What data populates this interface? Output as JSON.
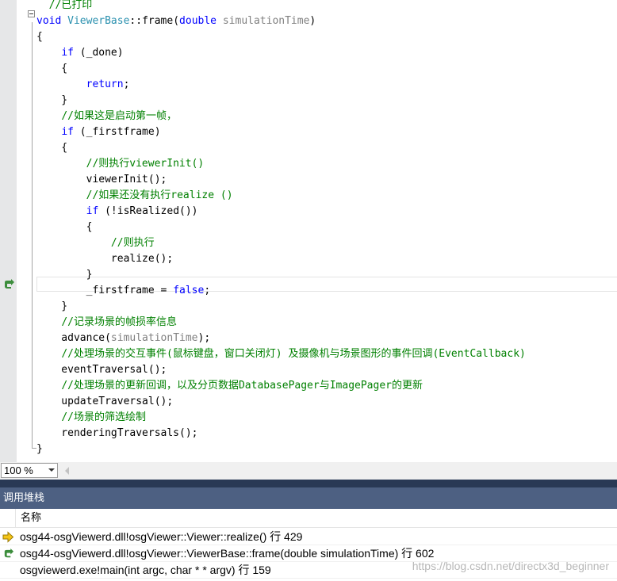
{
  "editor": {
    "lines": [
      {
        "tokens": [
          {
            "t": "  //已打印",
            "c": "cm"
          }
        ]
      },
      {
        "tokens": [
          {
            "t": "void ",
            "c": "kw"
          },
          {
            "t": "ViewerBase",
            "c": "type"
          },
          {
            "t": "::frame(",
            "c": "plain"
          },
          {
            "t": "double ",
            "c": "kw"
          },
          {
            "t": "simulationTime",
            "c": "param"
          },
          {
            "t": ")",
            "c": "plain"
          }
        ]
      },
      {
        "tokens": [
          {
            "t": "{",
            "c": "plain"
          }
        ]
      },
      {
        "tokens": [
          {
            "t": "    ",
            "c": "plain"
          },
          {
            "t": "if",
            "c": "kw"
          },
          {
            "t": " (_done)",
            "c": "plain"
          }
        ]
      },
      {
        "tokens": [
          {
            "t": "    {",
            "c": "plain"
          }
        ]
      },
      {
        "tokens": [
          {
            "t": "        ",
            "c": "plain"
          },
          {
            "t": "return",
            "c": "kw"
          },
          {
            "t": ";",
            "c": "plain"
          }
        ]
      },
      {
        "tokens": [
          {
            "t": "    }",
            "c": "plain"
          }
        ]
      },
      {
        "tokens": [
          {
            "t": "    ",
            "c": "plain"
          },
          {
            "t": "//如果这是启动第一帧，",
            "c": "cm"
          }
        ]
      },
      {
        "tokens": [
          {
            "t": "    ",
            "c": "plain"
          },
          {
            "t": "if",
            "c": "kw"
          },
          {
            "t": " (_firstframe)",
            "c": "plain"
          }
        ]
      },
      {
        "tokens": [
          {
            "t": "    {",
            "c": "plain"
          }
        ]
      },
      {
        "tokens": [
          {
            "t": "        ",
            "c": "plain"
          },
          {
            "t": "//则执行viewerInit()",
            "c": "cm"
          }
        ]
      },
      {
        "tokens": [
          {
            "t": "        viewerInit();",
            "c": "plain"
          }
        ]
      },
      {
        "tokens": [
          {
            "t": "        ",
            "c": "plain"
          },
          {
            "t": "//如果还没有执行realize ()",
            "c": "cm"
          }
        ]
      },
      {
        "tokens": [
          {
            "t": "        ",
            "c": "plain"
          },
          {
            "t": "if",
            "c": "kw"
          },
          {
            "t": " (!isRealized())",
            "c": "plain"
          }
        ]
      },
      {
        "tokens": [
          {
            "t": "        {",
            "c": "plain"
          }
        ]
      },
      {
        "tokens": [
          {
            "t": "            ",
            "c": "plain"
          },
          {
            "t": "//则执行",
            "c": "cm"
          }
        ]
      },
      {
        "tokens": [
          {
            "t": "            realize();",
            "c": "plain"
          }
        ]
      },
      {
        "tokens": [
          {
            "t": "        }",
            "c": "plain"
          }
        ]
      },
      {
        "tokens": [
          {
            "t": "        _firstframe = ",
            "c": "plain"
          },
          {
            "t": "false",
            "c": "kw"
          },
          {
            "t": ";",
            "c": "plain"
          }
        ]
      },
      {
        "tokens": [
          {
            "t": "    }",
            "c": "plain"
          }
        ]
      },
      {
        "tokens": [
          {
            "t": "    ",
            "c": "plain"
          },
          {
            "t": "//记录场景的帧损率信息",
            "c": "cm"
          }
        ]
      },
      {
        "tokens": [
          {
            "t": "    advance(",
            "c": "plain"
          },
          {
            "t": "simulationTime",
            "c": "param"
          },
          {
            "t": ");",
            "c": "plain"
          }
        ]
      },
      {
        "tokens": [
          {
            "t": "    ",
            "c": "plain"
          },
          {
            "t": "//处理场景的交互事件(鼠标键盘，窗口关闭灯) 及摄像机与场景图形的事件回调(EventCallback)",
            "c": "cm"
          }
        ]
      },
      {
        "tokens": [
          {
            "t": "    eventTraversal();",
            "c": "plain"
          }
        ]
      },
      {
        "tokens": [
          {
            "t": "    ",
            "c": "plain"
          },
          {
            "t": "//处理场景的更新回调，以及分页数据DatabasePager与ImagePager的更新",
            "c": "cm"
          }
        ]
      },
      {
        "tokens": [
          {
            "t": "    updateTraversal();",
            "c": "plain"
          }
        ]
      },
      {
        "tokens": [
          {
            "t": "    ",
            "c": "plain"
          },
          {
            "t": "//场景的筛选绘制",
            "c": "cm"
          }
        ]
      },
      {
        "tokens": [
          {
            "t": "    renderingTraversals();",
            "c": "plain"
          }
        ]
      },
      {
        "tokens": [
          {
            "t": "}",
            "c": "plain"
          }
        ]
      }
    ],
    "current_line_index": 18
  },
  "zoom": {
    "value": "100 %"
  },
  "callstack": {
    "title": "调用堆栈",
    "column_name": "名称",
    "rows": [
      {
        "text": "osg44-osgViewerd.dll!osgViewer::Viewer::realize() 行 429",
        "icon": "current-frame-arrow-icon"
      },
      {
        "text": "osg44-osgViewerd.dll!osgViewer::ViewerBase::frame(double simulationTime) 行 602",
        "icon": "return-point-arrow-icon"
      },
      {
        "text": "osgviewerd.exe!main(int argc, char * * argv) 行 159",
        "icon": ""
      }
    ]
  },
  "watermark": "https://blog.csdn.net/directx3d_beginner",
  "colors": {
    "keyword": "#0000ff",
    "type": "#2b91af",
    "comment": "#008000",
    "parameter": "#808080",
    "panel_title_bg": "#4d6082",
    "current_frame_arrow": "#f5c518",
    "return_arrow": "#3c8d3c"
  }
}
